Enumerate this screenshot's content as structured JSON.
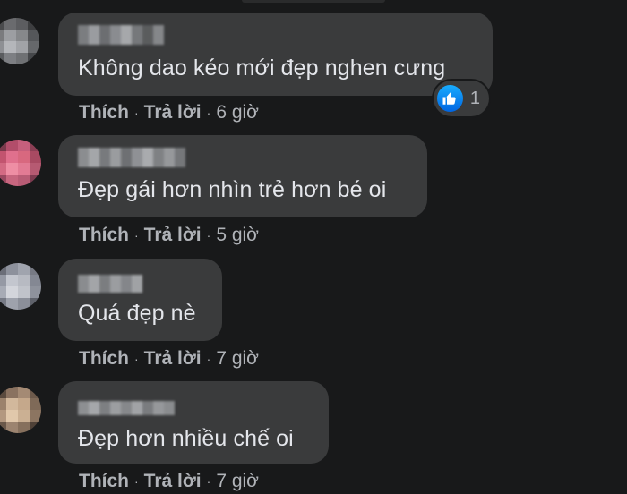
{
  "comments": [
    {
      "text": "Không dao kéo mới đẹp nghen cưng",
      "actions": {
        "like": "Thích",
        "reply": "Trả lời",
        "time": "6 giờ"
      },
      "reaction": {
        "icon": "like-icon",
        "count": "1"
      }
    },
    {
      "text": "Đẹp gái hơn nhìn trẻ hơn bé oi",
      "actions": {
        "like": "Thích",
        "reply": "Trả lời",
        "time": "5 giờ"
      }
    },
    {
      "text": "Quá đẹp nè",
      "actions": {
        "like": "Thích",
        "reply": "Trả lời",
        "time": "7 giờ"
      }
    },
    {
      "text": "Đẹp hơn nhiều chế oi",
      "actions": {
        "like": "Thích",
        "reply": "Trả lời",
        "time": "7 giờ"
      }
    }
  ],
  "colors": {
    "background": "#18191a",
    "bubble": "#3a3b3c",
    "text": "#e4e6eb",
    "secondary_text": "#b0b3b8",
    "like_blue": "#1877f2"
  }
}
